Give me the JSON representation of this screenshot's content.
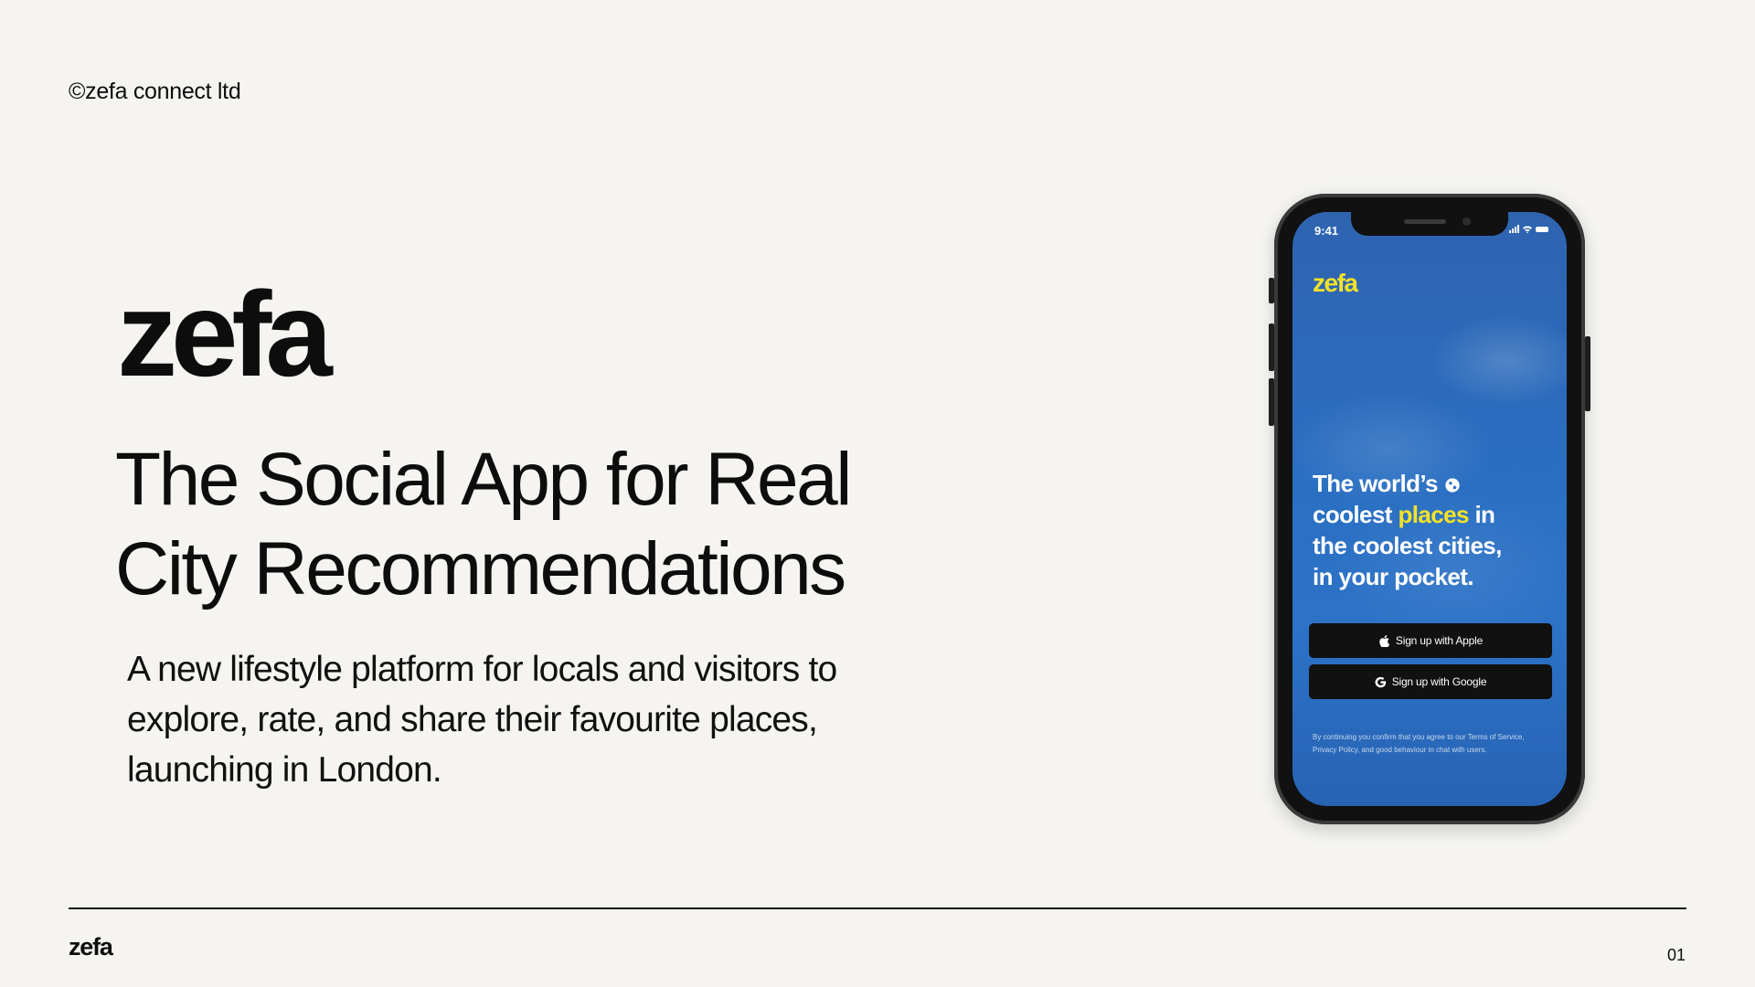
{
  "header": {
    "copyright": "©zefa connect ltd"
  },
  "hero": {
    "logo": "zefa",
    "headline": "The Social App for Real City Recommendations",
    "subtext": "A new lifestyle platform for locals and visitors to explore, rate, and share their favourite places, launching in London."
  },
  "phone": {
    "status_time": "9:41",
    "app_logo": "zefa",
    "tagline": {
      "part1": "The world’s",
      "part2": "coolest",
      "highlight": "places",
      "part3": "in the coolest cities, in your pocket."
    },
    "buttons": {
      "apple_label": "Sign up with Apple",
      "google_label": "Sign up with Google"
    },
    "legal": "By continuing you confirm that you agree to our Terms of Service, Privacy Policy, and good behaviour in chat with users.",
    "colors": {
      "accent": "#f3e226",
      "sky": "#2c6cc0",
      "button": "#111111"
    }
  },
  "footer": {
    "logo": "zefa",
    "page_number": "01"
  }
}
